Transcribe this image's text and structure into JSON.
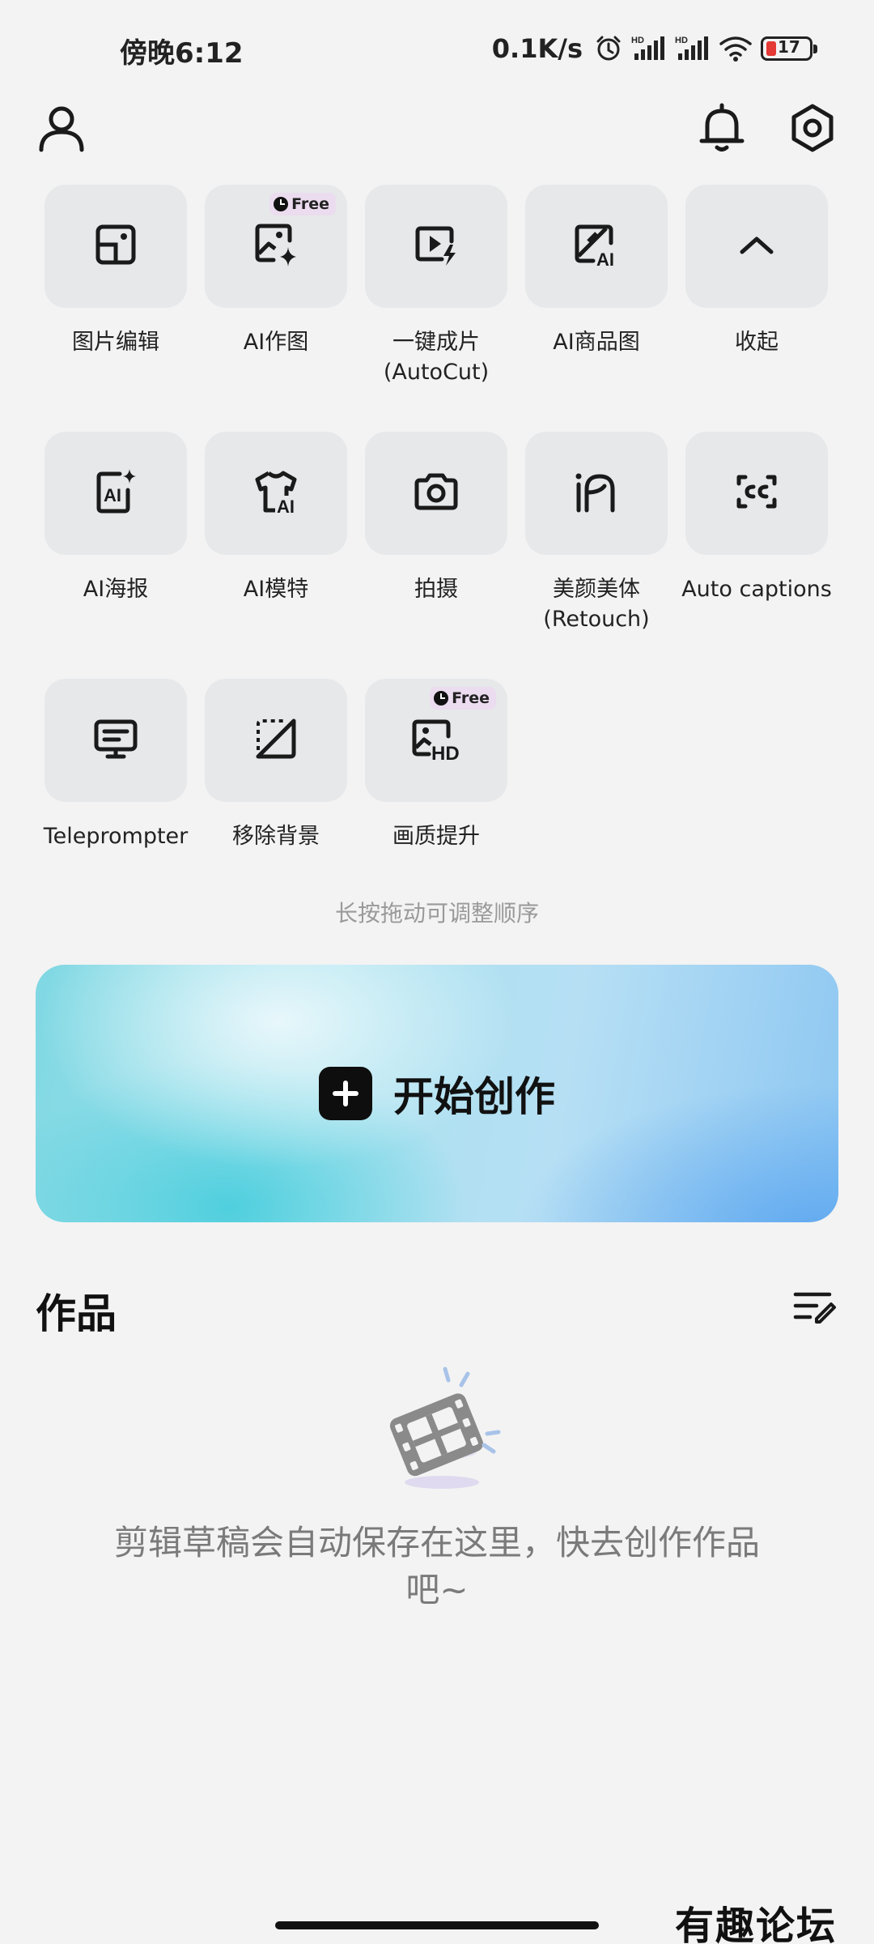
{
  "status_bar": {
    "time": "傍晚6:12",
    "net_speed": "0.1K/s",
    "battery_level": "17",
    "icons": [
      "alarm-icon",
      "signal-hd-icon",
      "signal-hd-icon",
      "wifi-icon",
      "battery-icon"
    ],
    "battery_color": "#e53935"
  },
  "header": {
    "icons": [
      "profile-icon",
      "notification-bell-icon",
      "settings-icon"
    ]
  },
  "tools": {
    "badge_free": "Free",
    "items": [
      {
        "label": "图片编辑",
        "icon": "photo-edit-icon"
      },
      {
        "label": "AI作图",
        "icon": "ai-image-icon",
        "badge": "Free"
      },
      {
        "label": "一键成片\n(AutoCut)",
        "icon": "autocut-icon"
      },
      {
        "label": "AI商品图",
        "icon": "ai-product-icon"
      },
      {
        "label": "收起",
        "icon": "chevron-up-icon"
      },
      {
        "label": "AI海报",
        "icon": "ai-poster-icon"
      },
      {
        "label": "AI模特",
        "icon": "ai-model-icon"
      },
      {
        "label": "拍摄",
        "icon": "camera-icon"
      },
      {
        "label": "美颜美体\n(Retouch)",
        "icon": "retouch-icon"
      },
      {
        "label": "Auto captions",
        "icon": "captions-icon"
      },
      {
        "label": "Teleprompter",
        "icon": "teleprompter-icon"
      },
      {
        "label": "移除背景",
        "icon": "remove-background-icon"
      },
      {
        "label": "画质提升",
        "icon": "hd-enhance-icon",
        "badge": "Free"
      }
    ]
  },
  "hint": "长按拖动可调整顺序",
  "create": {
    "label": "开始创作"
  },
  "works": {
    "title": "作品",
    "empty_text": "剪辑草稿会自动保存在这里，快去创作作品吧~"
  },
  "watermark": "有趣论坛",
  "colors": {
    "background": "#f3f3f3",
    "tile": "#e6e8ea",
    "free_badge": "#ecdcef",
    "banner_start": "#7fd8e3",
    "banner_end": "#8ec7f2"
  }
}
